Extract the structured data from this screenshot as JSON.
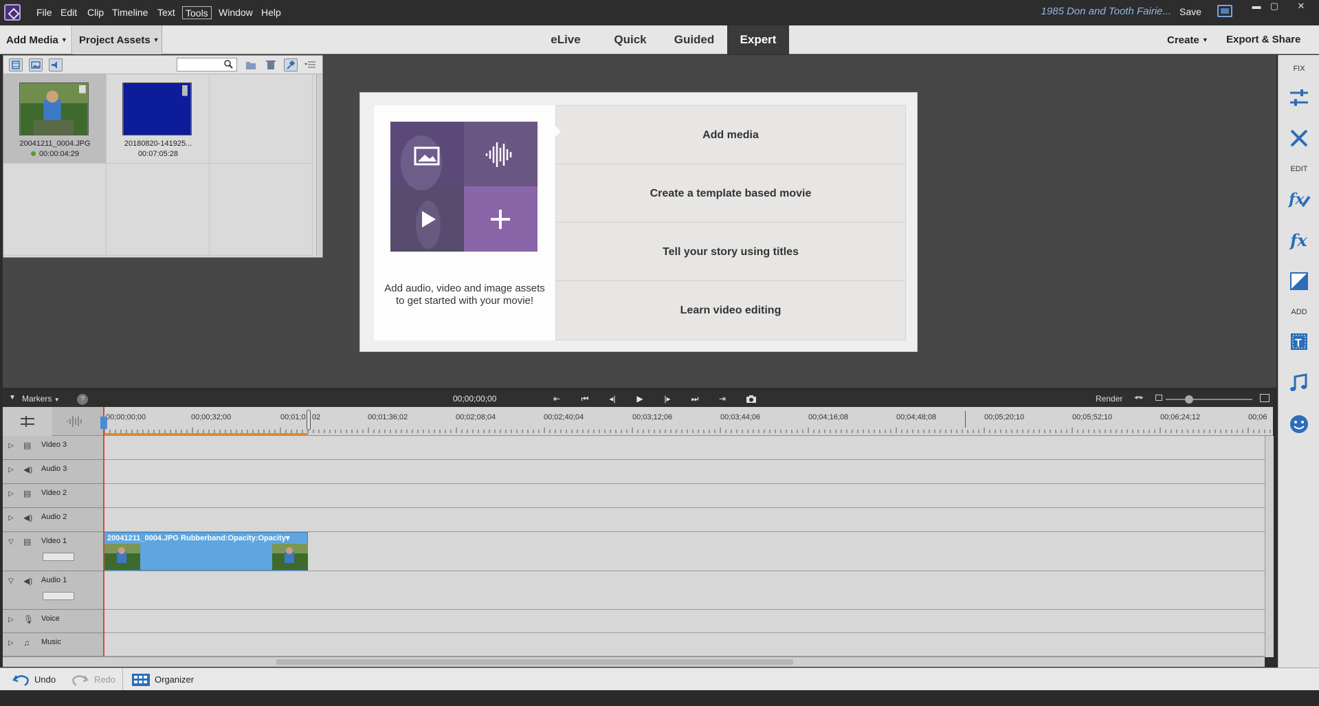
{
  "app": {
    "title": "1985 Don and Tooth Fairie...",
    "save_label": "Save"
  },
  "menu": [
    "File",
    "Edit",
    "Clip",
    "Timeline",
    "Text",
    "Tools",
    "Window",
    "Help"
  ],
  "window_controls": {
    "minimize": "▬",
    "restore": "▢",
    "close": "✕"
  },
  "modebar": {
    "add_media": "Add Media",
    "project_assets": "Project Assets",
    "tabs": [
      "eLive",
      "Quick",
      "Guided",
      "Expert"
    ],
    "active_tab": "Expert",
    "create": "Create",
    "export_share": "Export & Share"
  },
  "assets": {
    "search_placeholder": "",
    "items": [
      {
        "name": "20041211_0004.JPG",
        "duration": "00:00:04:29"
      },
      {
        "name": "20180820-141925...",
        "duration": "00:07:05:28"
      }
    ]
  },
  "start": {
    "hint": "Add audio, video and image assets to get started with your movie!",
    "options": [
      "Add media",
      "Create a template based movie",
      "Tell your story using titles",
      "Learn video editing"
    ]
  },
  "right_panel": {
    "fix": "FIX",
    "edit": "EDIT",
    "add": "ADD",
    "icons": [
      "adjustments-icon",
      "tools-icon",
      "fx-edit-icon",
      "fx-icon",
      "transitions-icon",
      "title-icon",
      "music-icon",
      "graphics-icon"
    ]
  },
  "timeline": {
    "markers": "Markers",
    "help": "?",
    "timecode": "00;00;00;00",
    "render": "Render",
    "ruler": [
      "00;00;00;00",
      "00;00;32;00",
      "00;01;0",
      "02",
      "00;01;36;02",
      "00;02;08;04",
      "00;02;40;04",
      "00;03;12;06",
      "00;03;44;06",
      "00;04;16;08",
      "00;04;48;08",
      "00;05;20;10",
      "00;05;52;10",
      "00;06;24;12",
      "00;06"
    ],
    "tracks": [
      "Video 3",
      "Audio 3",
      "Video 2",
      "Audio 2",
      "Video 1",
      "Audio 1",
      "Voice",
      "Music"
    ],
    "clip_label": "20041211_0004.JPG Rubberband:Opacity:Opacity▾"
  },
  "bottom": {
    "undo": "Undo",
    "redo": "Redo",
    "organizer": "Organizer"
  },
  "colors": {
    "accent": "#4c8bd3",
    "clip": "#5fa6e0",
    "playhead": "#d24a3a",
    "brand": "#4a2f73"
  }
}
